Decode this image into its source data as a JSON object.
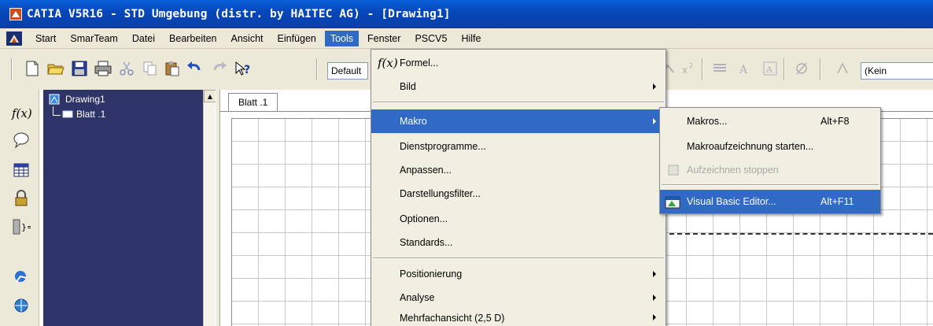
{
  "window": {
    "title": "CATIA V5R16 - STD Umgebung (distr. by HAITEC AG) - [Drawing1]"
  },
  "menubar": {
    "items": [
      "Start",
      "SmarTeam",
      "Datei",
      "Bearbeiten",
      "Ansicht",
      "Einfügen",
      "Tools",
      "Fenster",
      "PSCV5",
      "Hilfe"
    ],
    "active": "Tools"
  },
  "toolbar": {
    "style_combo": "Default",
    "font_combo": "(Kein"
  },
  "tree": {
    "root": "Drawing1",
    "child": "Blatt .1"
  },
  "sheet": {
    "tab_label": "Blatt .1"
  },
  "tools_menu": {
    "items": [
      {
        "label": "Formel...",
        "submenu": false
      },
      {
        "label": "Bild",
        "submenu": true
      },
      {
        "label": "Makro",
        "submenu": true,
        "highlighted": true
      },
      {
        "label": "Dienstprogramme...",
        "submenu": false
      },
      {
        "label": "Anpassen...",
        "submenu": false
      },
      {
        "label": "Darstellungsfilter...",
        "submenu": false
      },
      {
        "label": "Optionen...",
        "submenu": false
      },
      {
        "label": "Standards...",
        "submenu": false
      },
      {
        "label": "Positionierung",
        "submenu": true
      },
      {
        "label": "Analyse",
        "submenu": true
      },
      {
        "label": "Mehrfachansicht (2,5 D)",
        "submenu": true
      }
    ]
  },
  "makro_menu": {
    "items": [
      {
        "label": "Makros...",
        "shortcut": "Alt+F8"
      },
      {
        "label": "Makroaufzeichnung starten...",
        "shortcut": ""
      },
      {
        "label": "Aufzeichnen stoppen",
        "shortcut": "",
        "disabled": true
      },
      {
        "label": "Visual Basic Editor...",
        "shortcut": "Alt+F11",
        "highlighted": true
      }
    ]
  },
  "colors": {
    "titlebar": "#0646b8",
    "menubar": "#ece9d8",
    "highlight": "#316ac5",
    "tree_bg": "#2e3368"
  }
}
